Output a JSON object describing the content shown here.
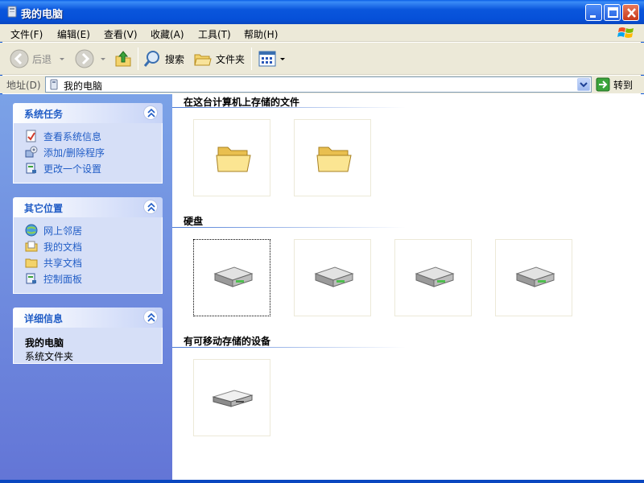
{
  "window": {
    "title": "我的电脑",
    "icon": "computer-icon",
    "buttons": [
      "minimize",
      "maximize",
      "close"
    ]
  },
  "menu": [
    {
      "label": "文件(F)"
    },
    {
      "label": "编辑(E)"
    },
    {
      "label": "查看(V)"
    },
    {
      "label": "收藏(A)"
    },
    {
      "label": "工具(T)"
    },
    {
      "label": "帮助(H)"
    }
  ],
  "toolbar": {
    "back_label": "后退",
    "search_label": "搜索",
    "folders_label": "文件夹"
  },
  "address": {
    "label": "地址(D)",
    "value": "我的电脑",
    "go_label": "转到"
  },
  "sidebar": {
    "system_tasks": {
      "title": "系统任务",
      "items": [
        {
          "label": "查看系统信息",
          "icon": "system-info-icon"
        },
        {
          "label": "添加/删除程序",
          "icon": "add-remove-programs-icon"
        },
        {
          "label": "更改一个设置",
          "icon": "control-panel-icon"
        }
      ]
    },
    "other_places": {
      "title": "其它位置",
      "items": [
        {
          "label": "网上邻居",
          "icon": "network-places-icon"
        },
        {
          "label": "我的文档",
          "icon": "my-documents-icon"
        },
        {
          "label": "共享文档",
          "icon": "shared-folder-icon"
        },
        {
          "label": "控制面板",
          "icon": "control-panel-icon"
        }
      ]
    },
    "details": {
      "title": "详细信息",
      "name": "我的电脑",
      "type": "系统文件夹"
    }
  },
  "groups": [
    {
      "title": "在这台计算机上存储的文件",
      "item_count": 2,
      "icon": "folder-icon"
    },
    {
      "title": "硬盘",
      "item_count": 4,
      "icon": "hard-drive-icon"
    },
    {
      "title": "有可移动存储的设备",
      "item_count": 1,
      "icon": "removable-drive-icon"
    }
  ],
  "colors": {
    "titlebar": "#0a56dc",
    "sidebar_bg": "#7ba2e7",
    "panel_title": "#215dc6",
    "chrome": "#ece9d8"
  }
}
